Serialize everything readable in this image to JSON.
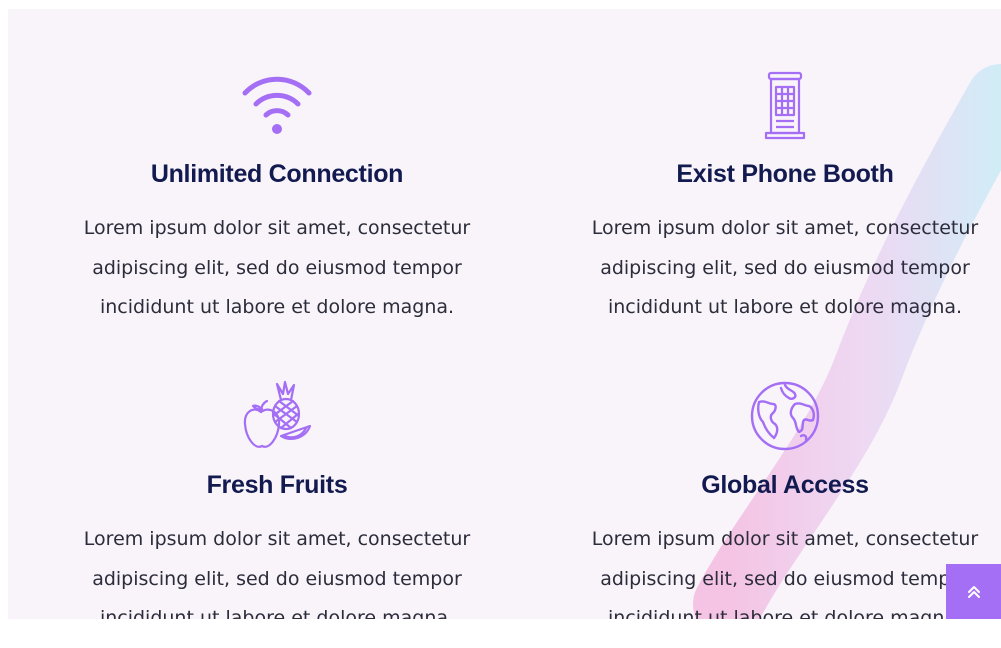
{
  "features": [
    {
      "icon": "wifi-icon",
      "title": "Unlimited Connection",
      "line1": "Lorem ipsum dolor sit amet, consectetur",
      "line2": "adipiscing elit, sed do eiusmod tempor",
      "line3": "incididunt ut labore et dolore magna."
    },
    {
      "icon": "phone-booth-icon",
      "title": "Exist Phone Booth",
      "line1": "Lorem ipsum dolor sit amet, consectetur",
      "line2": "adipiscing elit, sed do eiusmod tempor",
      "line3": "incididunt ut labore et dolore magna."
    },
    {
      "icon": "fruits-icon",
      "title": "Fresh Fruits",
      "line1": "Lorem ipsum dolor sit amet, consectetur",
      "line2": "adipiscing elit, sed do eiusmod tempor",
      "line3": "incididunt ut labore et dolore magna."
    },
    {
      "icon": "globe-icon",
      "title": "Global Access",
      "line1": "Lorem ipsum dolor sit amet, consectetur",
      "line2": "adipiscing elit, sed do eiusmod tempor",
      "line3": "incididunt ut labore et dolore magna."
    }
  ],
  "scroll_top": {
    "icon": "double-chevron-up-icon"
  },
  "colors": {
    "accent": "#a46ef5",
    "heading": "#121a4f",
    "text": "#2c2c3a",
    "background": "#f8f4fa"
  }
}
